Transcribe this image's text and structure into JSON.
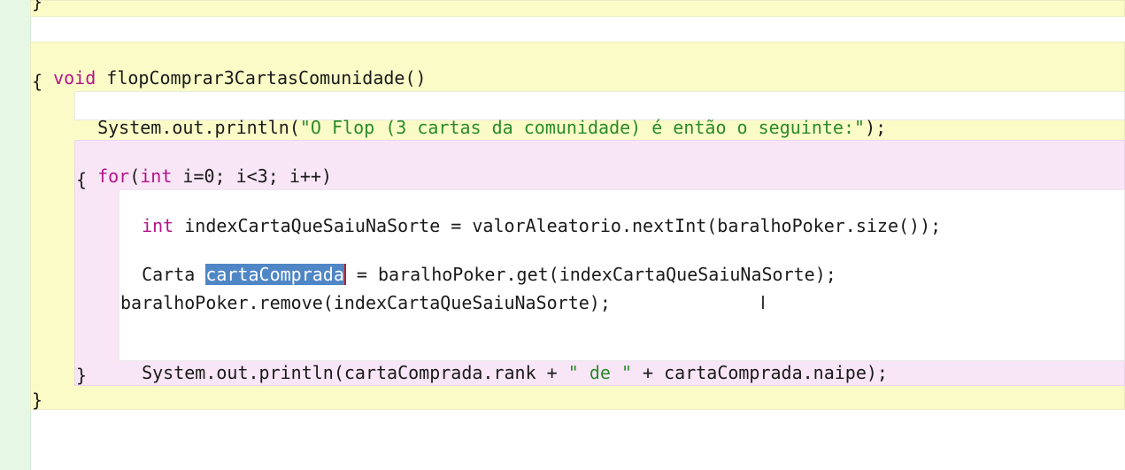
{
  "editor": {
    "top_brace": "}",
    "method_keyword": "void",
    "method_signature": " flopComprar3CartasComunidade()",
    "open_brace_method": "{",
    "print1_prefix": "System.out.println(",
    "print1_string": "\"O Flop (3 cartas da comunidade) é então o seguinte:\"",
    "print1_suffix": ");",
    "for_keyword": "for",
    "for_paren_open": "(",
    "for_int_keyword": "int",
    "for_rest": " i=0; i<3; i++)",
    "open_brace_for": "{",
    "line_int_keyword": "int",
    "line_index_rest": " indexCartaQueSaiuNaSorte = valorAleatorio.nextInt(baralhoPoker.size());",
    "line_carta_type": "Carta ",
    "line_carta_selected": "cartaComprada",
    "line_carta_rest": " = baralhoPoker.get(indexCartaQueSaiuNaSorte);",
    "line_remove": "baralhoPoker.remove(indexCartaQueSaiuNaSorte);",
    "print2_prefix": "System.out.println(cartaComprada.rank + ",
    "print2_string": "\" de \"",
    "print2_suffix": " + cartaComprada.naipe);",
    "close_brace_for": "}",
    "close_brace_method": "}"
  },
  "mouse_cursor_glyph": "I"
}
